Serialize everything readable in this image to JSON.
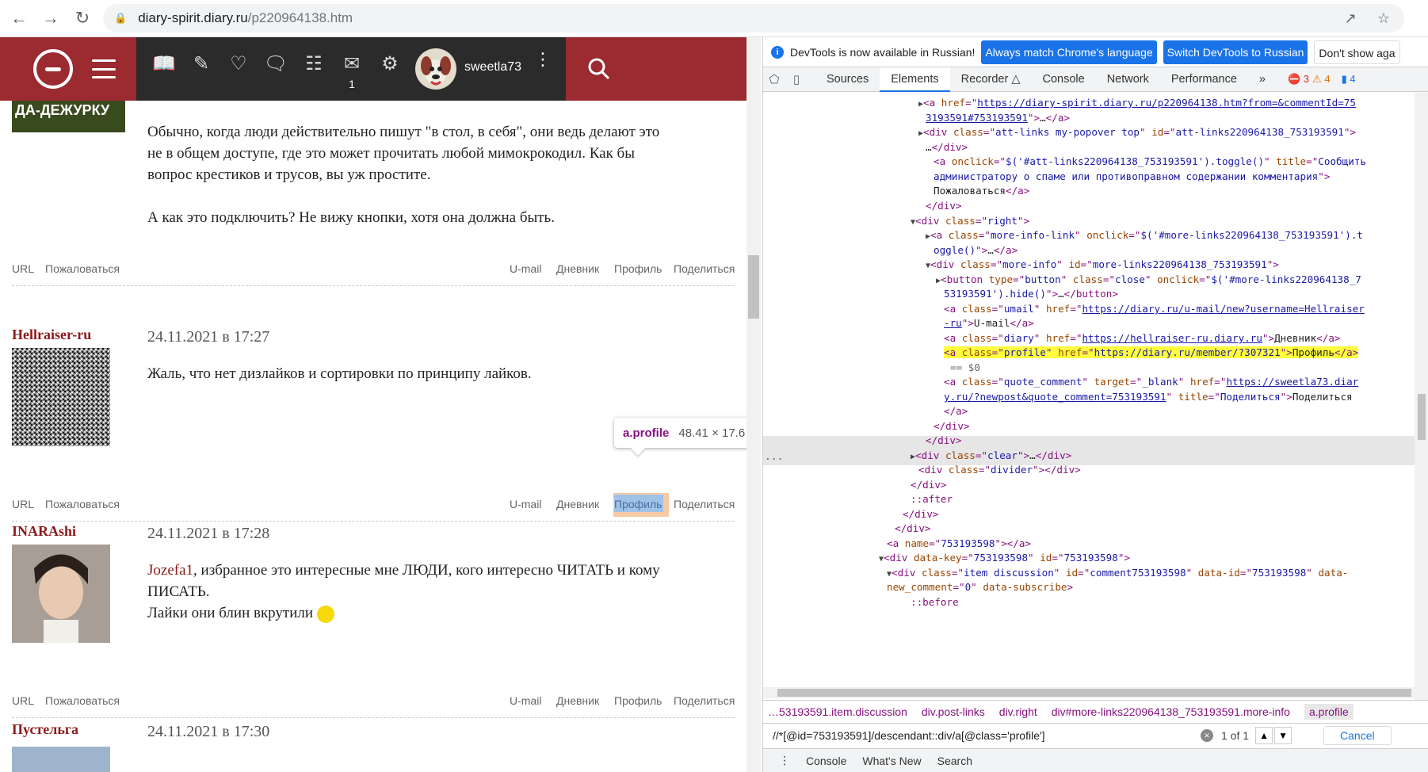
{
  "browser": {
    "url_domain": "diary-spirit.diary.ru",
    "url_path": "/p220964138.htm"
  },
  "site": {
    "username": "sweetla73",
    "mail_count": "1"
  },
  "posts": [
    {
      "text_lines": [
        "Обычно, когда люди действительно пишут \"в стол, в себя\", они ведь делают это",
        "не в общем доступе, где это может прочитать любой мимокрокодил. Как бы",
        "вопрос крестиков и трусов, вы уж простите.",
        "",
        "А как это подключить? Не вижу кнопки, хотя она должна быть."
      ],
      "banner": "ДА-ДЕЖУРКУ"
    },
    {
      "author": "Hellraiser-ru",
      "date": "24.11.2021 в 17:27",
      "text": "Жаль, что нет дизлайков и сортировки по принципу лайков."
    },
    {
      "author": "INARAshi",
      "date": "24.11.2021 в 17:28",
      "text_link": "Jozefa1",
      "text1": ", избранное это интересные мне ЛЮДИ, кого интересно ЧИТАТЬ и кому",
      "text2": "ПИСАТЬ.",
      "text3": "Лайки они блин вкрутили"
    },
    {
      "author": "Пустельга",
      "date": "24.11.2021 в 17:30"
    }
  ],
  "links": {
    "url": "URL",
    "report": "Пожаловаться",
    "umail": "U-mail",
    "diary": "Дневник",
    "profile": "Профиль",
    "share": "Поделиться"
  },
  "tooltip": {
    "tag": "a.profile",
    "dims": "48.41 × 17.6"
  },
  "devtools": {
    "info_text": "DevTools is now available in Russian!",
    "btn_match": "Always match Chrome's language",
    "btn_switch": "Switch DevTools to Russian",
    "btn_dont": "Don't show aga",
    "tabs": [
      "Sources",
      "Elements",
      "Recorder",
      "Console",
      "Network",
      "Performance"
    ],
    "errors": "3",
    "warnings": "4",
    "messages": "4",
    "breadcrumbs": [
      "…53193591.item.discussion",
      "div.post-links",
      "div.right",
      "div#more-links220964138_753193591.more-info",
      "a.profile"
    ],
    "xpath_query": "//*[@id=753193591]/descendant::div/a[@class='profile']",
    "match_count": "1 of 1",
    "cancel": "Cancel",
    "drawer_tabs": [
      "Console",
      "What's New",
      "Search"
    ]
  }
}
